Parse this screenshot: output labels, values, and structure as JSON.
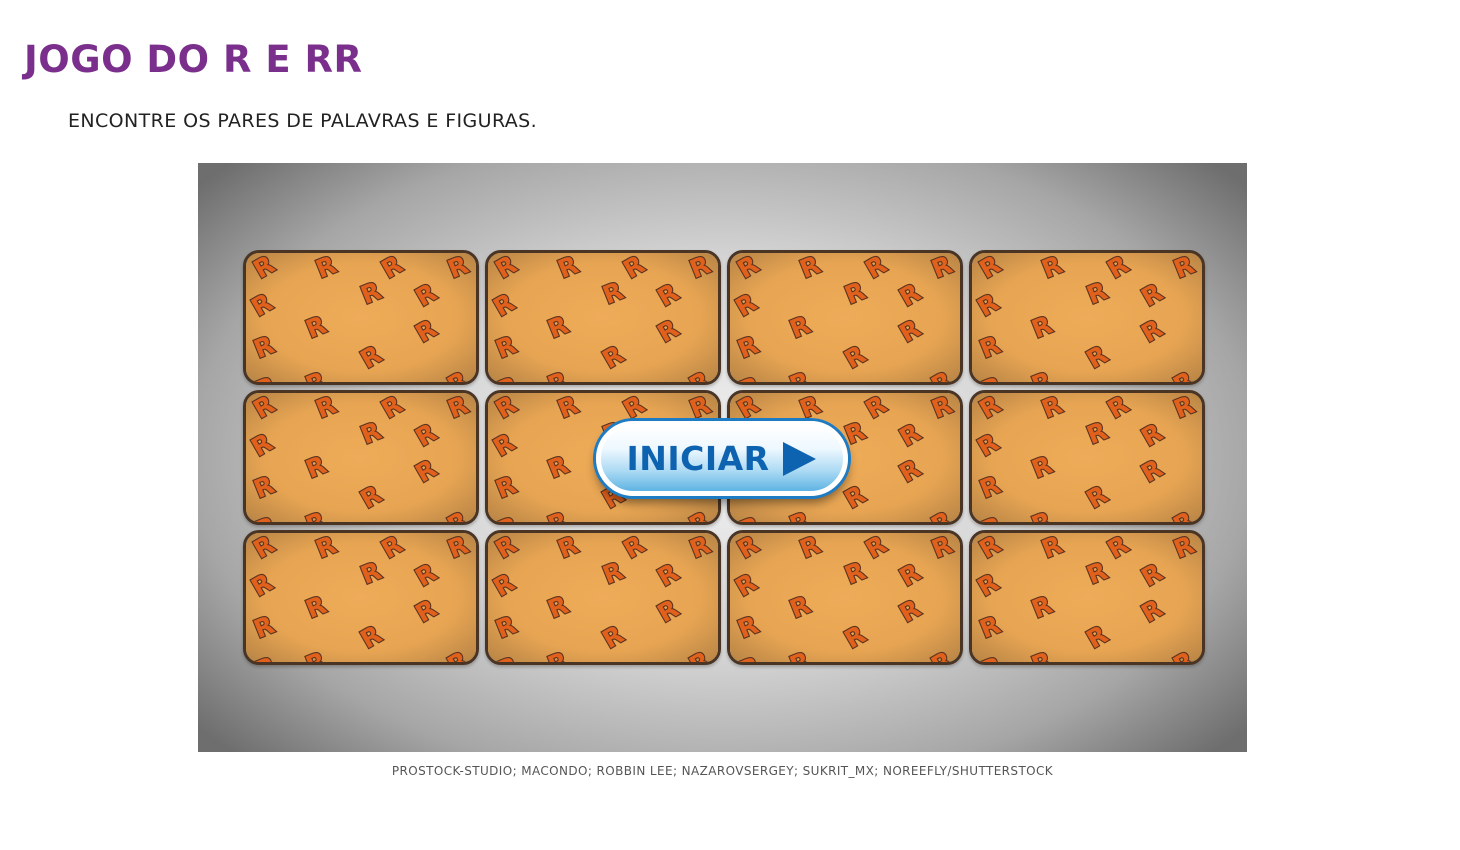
{
  "header": {
    "title": "JOGO DO R E RR",
    "instructions": "ENCONTRE OS PARES DE PALAVRAS E FIGURAS."
  },
  "game": {
    "card_back_letter": "R",
    "rows": 3,
    "columns": 4,
    "cards_count": 12,
    "start_button_label": "INICIAR",
    "start_button_icon": "play-arrow-icon",
    "colors": {
      "card_face": "#e7a553",
      "card_letter": "#e0601c",
      "card_border": "#4a3424",
      "button_text": "#0e63b0"
    }
  },
  "footer": {
    "credits": "PROSTOCK-STUDIO; MACONDO; ROBBIN LEE; NAZAROVSERGEY; SUKRIT_MX; NOREEFLY/SHUTTERSTOCK"
  }
}
